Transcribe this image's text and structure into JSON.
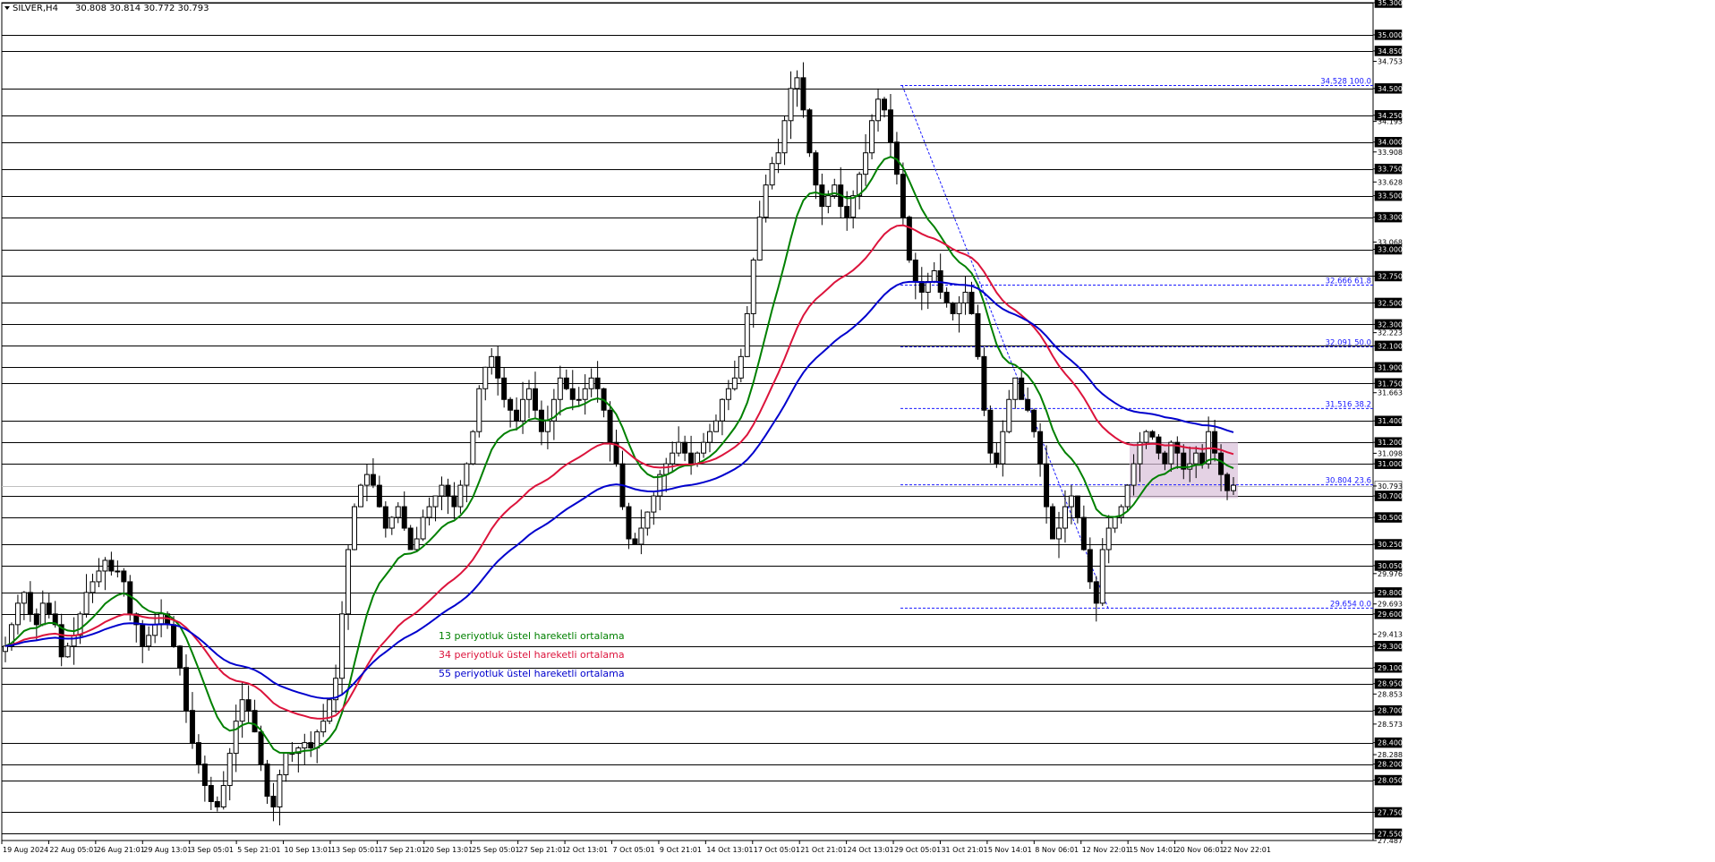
{
  "header": {
    "symbol": "SILVER,H4",
    "ohlc": "30.808 30.814 30.772 30.793"
  },
  "colors": {
    "candle": "#000000",
    "grid": "#000000",
    "ema13": "#008000",
    "ema34": "#dc143c",
    "ema55": "#0000cd",
    "fib": "#1a1aff",
    "zone": "#d8bfd8",
    "current": "#c0c0c0"
  },
  "legend": [
    {
      "label": "13 periyotluk üstel hareketli ortalama",
      "color": "#008000"
    },
    {
      "label": "34 periyotluk üstel hareketli ortalama",
      "color": "#dc143c"
    },
    {
      "label": "55 periyotluk üstel hareketli ortalama",
      "color": "#0000cd"
    }
  ],
  "chart_data": {
    "type": "candlestick",
    "ylim": [
      27.487,
      35.3
    ],
    "current_price": 30.793,
    "price_labels": [
      "35.300",
      "35.000",
      "34.850",
      "34.753",
      "34.500",
      "34.250",
      "34.193",
      "34.000",
      "33.908",
      "33.750",
      "33.628",
      "33.500",
      "33.300",
      "33.068",
      "33.000",
      "32.750",
      "32.500",
      "32.300",
      "32.223",
      "32.100",
      "31.900",
      "31.750",
      "31.663",
      "31.400",
      "31.200",
      "31.098",
      "31.000",
      "30.793",
      "30.700",
      "30.500",
      "30.250",
      "30.050",
      "29.976",
      "29.800",
      "29.693",
      "29.600",
      "29.413",
      "29.300",
      "29.100",
      "28.950",
      "28.853",
      "28.700",
      "28.573",
      "28.400",
      "28.288",
      "28.200",
      "28.050",
      "27.750",
      "27.550",
      "27.487"
    ],
    "level_lines": [
      35.3,
      35.0,
      34.85,
      34.5,
      34.25,
      34.0,
      33.75,
      33.5,
      33.3,
      33.0,
      32.75,
      32.5,
      32.3,
      32.1,
      31.9,
      31.75,
      31.4,
      31.2,
      31.0,
      30.7,
      30.5,
      30.25,
      30.05,
      29.8,
      29.6,
      29.3,
      29.1,
      28.95,
      28.7,
      28.4,
      28.2,
      28.05,
      27.75,
      27.55
    ],
    "x_labels": [
      "19 Aug 2024",
      "22 Aug 05:01",
      "26 Aug 21:01",
      "29 Aug 13:01",
      "3 Sep 05:01",
      "5 Sep 21:01",
      "10 Sep 13:01",
      "13 Sep 05:01",
      "17 Sep 21:01",
      "20 Sep 13:01",
      "25 Sep 05:01",
      "27 Sep 21:01",
      "2 Oct 13:01",
      "7 Oct 05:01",
      "9 Oct 21:01",
      "14 Oct 13:01",
      "17 Oct 05:01",
      "21 Oct 21:01",
      "24 Oct 13:01",
      "29 Oct 05:01",
      "31 Oct 21:01",
      "5 Nov 14:01",
      "8 Nov 06:01",
      "12 Nov 22:01",
      "15 Nov 14:01",
      "20 Nov 06:01",
      "22 Nov 22:01"
    ],
    "close_path": [
      29.3,
      29.5,
      29.7,
      29.8,
      29.6,
      29.5,
      29.7,
      29.6,
      29.5,
      29.2,
      29.3,
      29.4,
      29.6,
      29.8,
      29.9,
      30.0,
      30.1,
      30.0,
      30.0,
      29.9,
      29.6,
      29.5,
      29.3,
      29.4,
      29.5,
      29.6,
      29.5,
      29.3,
      29.1,
      28.7,
      28.4,
      28.2,
      28.0,
      27.85,
      27.8,
      28.0,
      28.3,
      28.6,
      28.8,
      28.7,
      28.5,
      28.2,
      27.9,
      27.8,
      28.1,
      28.3,
      28.3,
      28.35,
      28.4,
      28.35,
      28.5,
      28.6,
      28.8,
      29.0,
      29.6,
      30.2,
      30.6,
      30.8,
      30.9,
      30.8,
      30.6,
      30.4,
      30.5,
      30.6,
      30.4,
      30.2,
      30.3,
      30.5,
      30.6,
      30.7,
      30.8,
      30.7,
      30.6,
      30.8,
      31.0,
      31.3,
      31.7,
      31.9,
      32.0,
      31.8,
      31.6,
      31.5,
      31.4,
      31.6,
      31.7,
      31.5,
      31.3,
      31.4,
      31.6,
      31.8,
      31.7,
      31.6,
      31.6,
      31.7,
      31.8,
      31.7,
      31.5,
      31.2,
      31.0,
      30.6,
      30.3,
      30.25,
      30.4,
      30.55,
      30.7,
      30.9,
      31.0,
      31.1,
      31.2,
      31.1,
      31.0,
      31.1,
      31.2,
      31.3,
      31.4,
      31.6,
      31.7,
      31.8,
      32.0,
      32.4,
      32.9,
      33.3,
      33.6,
      33.8,
      33.9,
      34.2,
      34.5,
      34.6,
      34.3,
      33.9,
      33.6,
      33.4,
      33.5,
      33.6,
      33.4,
      33.3,
      33.5,
      33.7,
      33.9,
      34.2,
      34.4,
      34.3,
      34.0,
      33.7,
      33.3,
      32.9,
      32.7,
      32.6,
      32.7,
      32.8,
      32.6,
      32.5,
      32.4,
      32.5,
      32.6,
      32.4,
      32.0,
      31.5,
      31.1,
      31.0,
      31.3,
      31.6,
      31.8,
      31.6,
      31.5,
      31.3,
      31.0,
      30.6,
      30.3,
      30.4,
      30.6,
      30.7,
      30.5,
      30.2,
      29.9,
      29.7,
      30.2,
      30.4,
      30.5,
      30.6,
      30.8,
      31.0,
      31.2,
      31.3,
      31.25,
      31.1,
      31.0,
      31.2,
      31.1,
      30.95,
      31.0,
      31.1,
      31.0,
      31.3,
      31.1,
      30.9,
      30.75,
      30.8
    ]
  },
  "fib_levels": [
    {
      "label": "34.528 100.0",
      "price": 34.528
    },
    {
      "label": "32.666 61.8",
      "price": 32.666
    },
    {
      "label": "32.091 50.0",
      "price": 32.091
    },
    {
      "label": "31.516 38.2",
      "price": 31.516
    },
    {
      "label": "30.804 23.6",
      "price": 30.804
    },
    {
      "label": "29.654 0.0",
      "price": 29.654
    }
  ]
}
